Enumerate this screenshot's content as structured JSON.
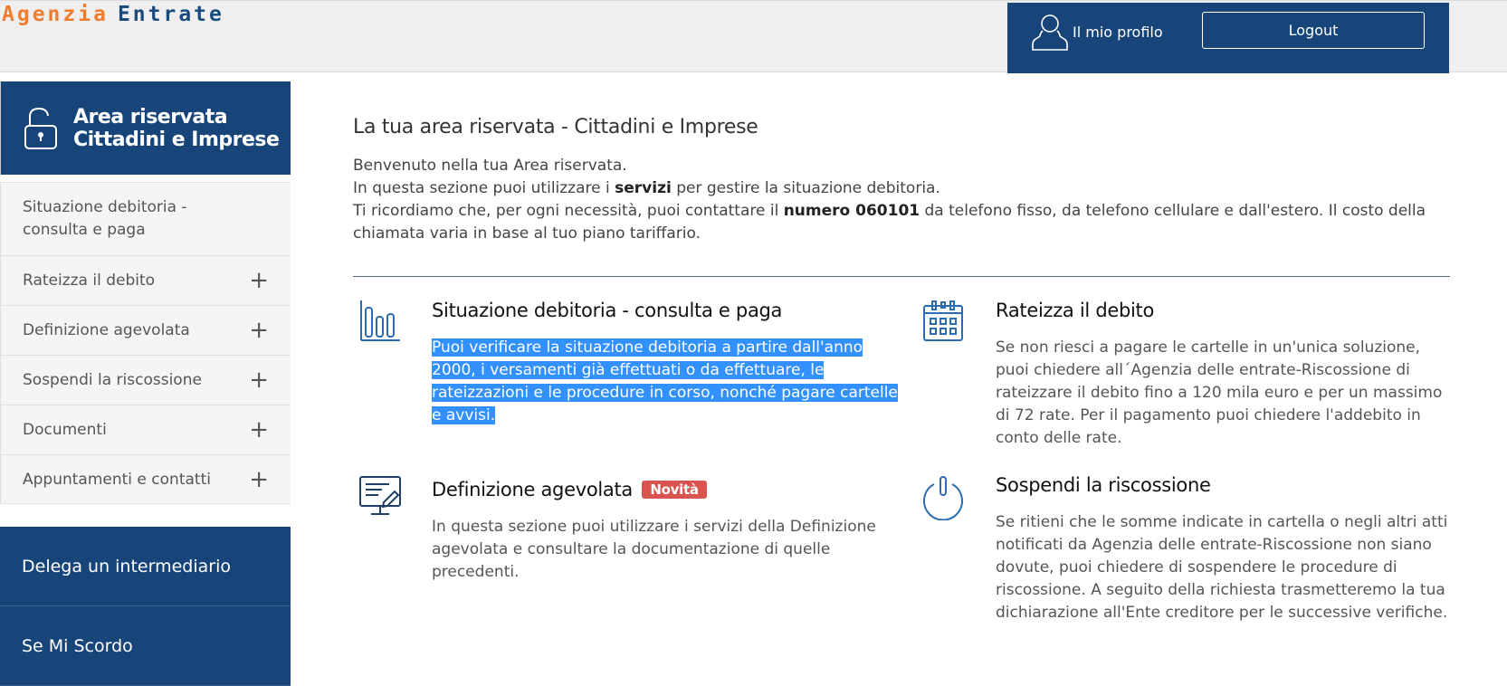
{
  "header": {
    "logo_part1": "Agenzia",
    "logo_part2": "Entrate",
    "profile_label": "Il mio profilo",
    "logout_label": "Logout"
  },
  "sidebar": {
    "area_title_line1": "Area riservata",
    "area_title_line2": "Cittadini e Imprese",
    "items": [
      {
        "label": "Situazione debitoria - consulta e paga"
      },
      {
        "label": "Rateizza il debito"
      },
      {
        "label": "Definizione agevolata"
      },
      {
        "label": "Sospendi la riscossione"
      },
      {
        "label": "Documenti"
      },
      {
        "label": "Appuntamenti e contatti"
      }
    ],
    "links": [
      "Delega un intermediario",
      "Se Mi Scordo"
    ]
  },
  "main": {
    "title": "La tua area riservata - Cittadini e Imprese",
    "intro_line1": "Benvenuto nella tua Area riservata.",
    "intro_line2_pre": "In questa sezione puoi utilizzare i ",
    "intro_line2_bold": "servizi",
    "intro_line2_post": " per gestire la situazione debitoria.",
    "intro_line3_pre": "Ti ricordiamo che, per ogni necessità, puoi contattare il ",
    "intro_line3_bold": "numero 060101",
    "intro_line3_post": " da telefono fisso, da telefono cellulare e dall'estero. Il costo della chiamata varia in base al tuo piano tariffario."
  },
  "cards": [
    {
      "title": "Situazione debitoria - consulta e paga",
      "text": "Puoi verificare la situazione debitoria a partire dall'anno 2000, i versamenti già effettuati o da effettuare, le rateizzazioni e le procedure in corso, nonché pagare cartelle e avvisi.",
      "icon": "bar-chart-icon"
    },
    {
      "title": "Rateizza il debito",
      "text": "Se non riesci a pagare le cartelle in un'unica soluzione, puoi chiedere all´Agenzia delle entrate-Riscossione di rateizzare il debito fino a 120 mila euro e per un massimo di 72 rate. Per il pagamento puoi chiedere l'addebito in conto delle rate.",
      "icon": "calendar-icon"
    },
    {
      "title": "Definizione agevolata",
      "badge": "Novità",
      "text": "In questa sezione puoi utilizzare i servizi della Definizione agevolata e consultare la documentazione di quelle precedenti.",
      "icon": "monitor-edit-icon"
    },
    {
      "title": "Sospendi la riscossione",
      "text": "Se ritieni che le somme indicate in cartella o negli altri atti notificati da Agenzia delle entrate-Riscossione non siano dovute, puoi chiedere di sospendere le procedure di riscossione. A seguito della richiesta trasmetteremo la tua dichiarazione all'Ente creditore per le successive verifiche.",
      "icon": "power-icon"
    }
  ],
  "colors": {
    "brand_blue": "#17457a",
    "logo_orange": "#f07c2e",
    "selection": "#3390ff",
    "badge_red": "#d9534f"
  }
}
